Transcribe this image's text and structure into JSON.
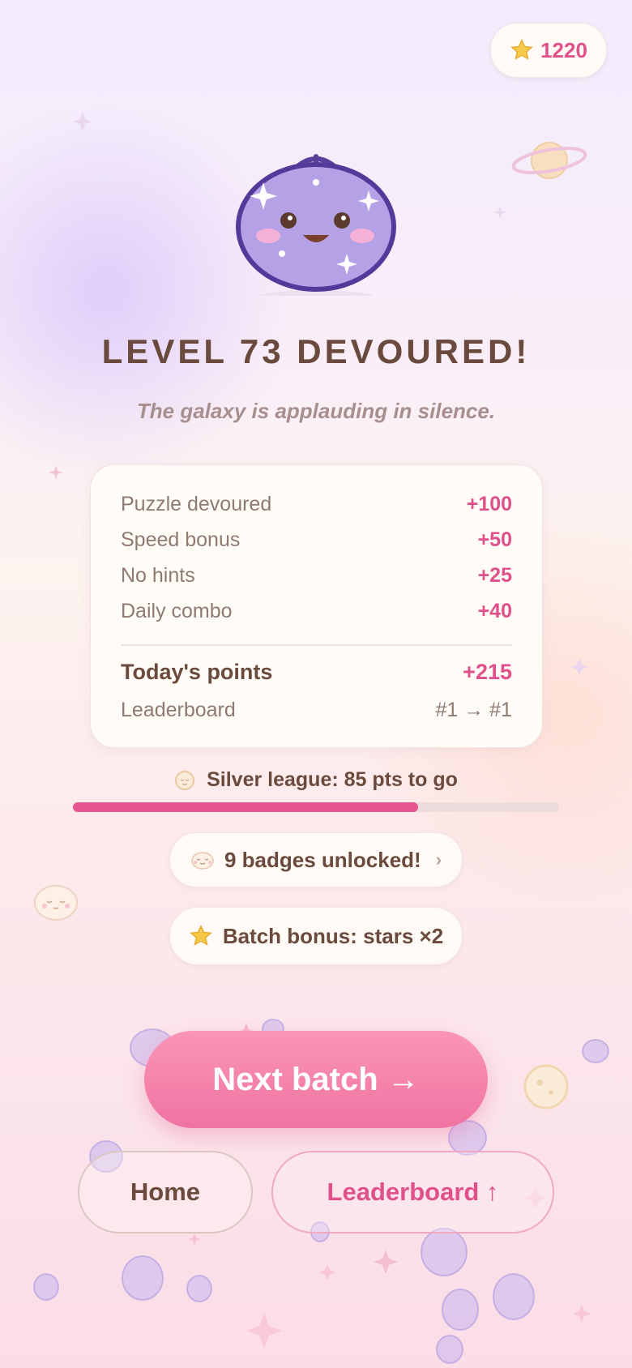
{
  "score": {
    "icon": "star-icon",
    "value": "1220"
  },
  "hero": {
    "icon": "plum-mascot-icon"
  },
  "title": "LEVEL 73 DEVOURED!",
  "subtitle": "The galaxy is applauding in silence.",
  "breakdown": {
    "rows": [
      {
        "label": "Puzzle devoured",
        "points": "+100"
      },
      {
        "label": "Speed bonus",
        "points": "+50"
      },
      {
        "label": "No hints",
        "points": "+25"
      },
      {
        "label": "Daily combo",
        "points": "+40"
      }
    ],
    "total_label": "Today's points",
    "total_points": "+215",
    "leaderboard_label": "Leaderboard",
    "leaderboard_value": "#1 → #1"
  },
  "league": {
    "icon": "moon-icon",
    "label": "Silver league: 85 pts to go",
    "progress_fraction": 0.71
  },
  "badges_chip": {
    "icon": "dumpling-icon",
    "label": "9 badges unlocked!",
    "chevron": "›"
  },
  "bonus_chip": {
    "icon": "star-icon",
    "label": "Batch bonus: stars ×2"
  },
  "buttons": {
    "next": "Next batch →",
    "home": "Home",
    "leaderboard": "Leaderboard ↑"
  },
  "colors": {
    "accent": "#e0508a",
    "text": "#6b4a3e",
    "button": "#f07fa9",
    "mascot": "#b5a1e6"
  }
}
